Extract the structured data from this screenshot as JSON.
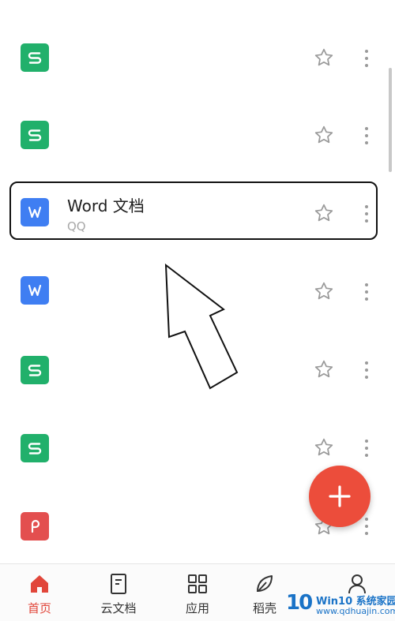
{
  "files": [
    {
      "type": "et",
      "title": "",
      "source": ""
    },
    {
      "type": "et",
      "title": "",
      "source": ""
    },
    {
      "type": "wps",
      "title": "Word 文档",
      "source": "QQ"
    },
    {
      "type": "wps",
      "title": "",
      "source": ""
    },
    {
      "type": "et",
      "title": "",
      "source": ""
    },
    {
      "type": "et",
      "title": "",
      "source": ""
    },
    {
      "type": "dps",
      "title": "",
      "source": ""
    }
  ],
  "file_icons": {
    "et": "spreadsheet-s-icon",
    "wps": "document-w-icon",
    "dps": "presentation-p-icon"
  },
  "colors": {
    "et": "#21b06b",
    "wps": "#3f7ef2",
    "dps": "#e34f4f",
    "accent": "#ec4d3b"
  },
  "nav": [
    {
      "label": "首页",
      "icon": "home-icon",
      "active": true
    },
    {
      "label": "云文档",
      "icon": "cloud-doc-icon",
      "active": false
    },
    {
      "label": "应用",
      "icon": "apps-grid-icon",
      "active": false
    },
    {
      "label": "稻壳",
      "icon": "leaf-icon",
      "active": false
    },
    {
      "label": "",
      "icon": "person-icon",
      "active": false
    }
  ],
  "watermark": {
    "logo": "10",
    "line1": "Win10 系统家园",
    "line2": "www.qdhuajin.com"
  }
}
